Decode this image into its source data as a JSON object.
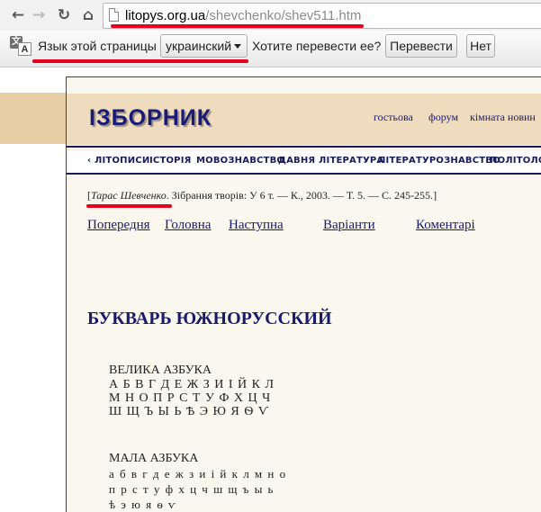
{
  "browser": {
    "nav": {
      "back_icon": "←",
      "forward_icon": "→",
      "reload_icon": "↻",
      "home_icon": "⌂"
    },
    "url": {
      "host": "litopys.org.ua",
      "path": "/shevchenko/shev511.htm"
    }
  },
  "translate_bar": {
    "icon_letter_a": "文",
    "icon_letter_b": "A",
    "page_language_label": "Язык этой страницы",
    "language_selected": "украинский",
    "question": "Хотите перевести ее?",
    "translate_button": "Перевести",
    "no_button": "Нет"
  },
  "site": {
    "logo": "ІЗБОРНИК",
    "top_links": [
      "гостьова",
      "форум",
      "кімната новин"
    ],
    "nav_items": [
      "‹ ЛІТОПИСИ",
      "ІСТОРІЯ",
      "МОВОЗНАВСТВО",
      "ДАВНЯ ЛІТЕРАТУРА",
      "ЛІТЕРАТУРОЗНАВСТВО",
      "ПОЛІТОЛОГІЯ"
    ]
  },
  "article": {
    "source_author": "Тарас Шевченко",
    "source_rest": ". Зібрання творів: У 6 т. — К., 2003. — Т. 5. — С. 245-255.",
    "page_links": [
      "Попередня",
      "Головна",
      "Наступна",
      "Варіанти",
      "Коментарі"
    ],
    "title": "БУКВАРЬ ЮЖНОРУССКИЙ",
    "uppercase": {
      "heading": "ВЕЛИКА АЗБУКА",
      "rows": [
        "А Б В Г Д Е Ж З И І Й К Л",
        "М Н О П Р С Т У Ф Х Ц Ч",
        "Ш Щ Ъ Ы Ь Ѣ Э Ю Я Ѳ Ѵ"
      ]
    },
    "lowercase": {
      "heading": "МАЛА АЗБУКА",
      "rows": [
        "а б в г д е ж з и і й к л м н о",
        "п р с т у ф х ц ч ш щ ъ ы ь",
        "ѣ э ю я ѳ ѵ"
      ]
    }
  },
  "colors": {
    "annotation_red": "#e8001c",
    "header_tan": "#e8cfa6",
    "link_navy": "#1a1a6a"
  }
}
